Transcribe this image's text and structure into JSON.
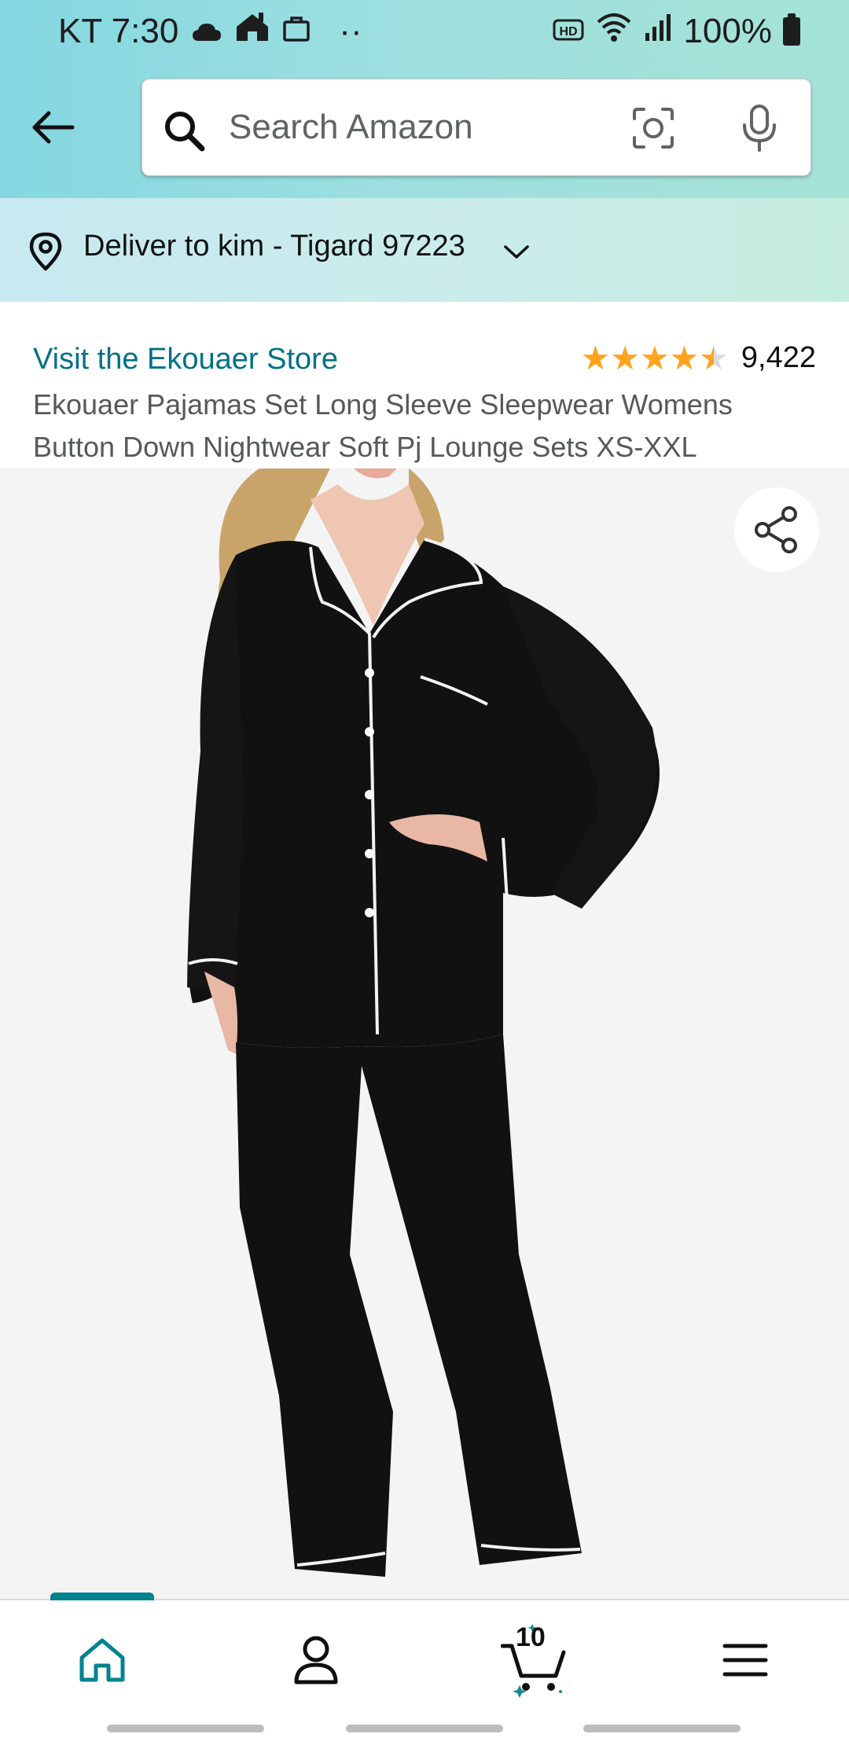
{
  "status_bar": {
    "carrier_time": "KT 7:30",
    "dots": "··",
    "hd_label": "HD",
    "battery": "100%"
  },
  "search": {
    "placeholder": "Search Amazon"
  },
  "delivery": {
    "text": "Deliver to kim - Tigard 97223"
  },
  "product": {
    "store_link": "Visit the Ekouaer Store",
    "rating_value": 4.5,
    "stars_glyphs": "★★★★★",
    "rating_count": "9,422",
    "title": "Ekouaer Pajamas Set Long Sleeve Sleepwear Womens Button Down Nightwear Soft Pj Lounge Sets XS-XXL"
  },
  "bottom_nav": {
    "items": [
      "home",
      "account",
      "cart",
      "menu"
    ],
    "cart_count": "10",
    "active": "home"
  },
  "colors": {
    "accent": "#007185",
    "star": "#ffa41c",
    "nav_active": "#00838f"
  }
}
